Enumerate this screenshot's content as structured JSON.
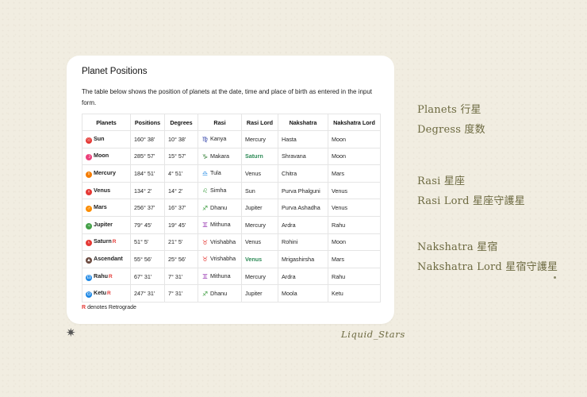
{
  "card": {
    "title": "Planet Positions",
    "description": "The table below shows the position of planets at the date, time and place of birth as entered in the input form.",
    "footnote_symbol": "R",
    "footnote_text": "denotes Retrograde"
  },
  "table": {
    "headers": [
      "Planets",
      "Positions",
      "Degrees",
      "Rasi",
      "Rasi Lord",
      "Nakshatra",
      "Nakshatra Lord"
    ],
    "rows": [
      {
        "planet": "Sun",
        "icon": "sun-icon",
        "icon_color": "#e53935",
        "retro": false,
        "position": "160° 38'",
        "degrees": "10° 38'",
        "rasi": "Kanya",
        "rasi_icon": "♍",
        "rasi_color": "#3949ab",
        "rasi_lord": "Mercury",
        "lord_bold": false,
        "nakshatra": "Hasta",
        "nakshatra_lord": "Moon"
      },
      {
        "planet": "Moon",
        "icon": "moon-icon",
        "icon_color": "#ec407a",
        "retro": false,
        "position": "285° 57'",
        "degrees": "15° 57'",
        "rasi": "Makara",
        "rasi_icon": "♑",
        "rasi_color": "#2e7d32",
        "rasi_lord": "Saturn",
        "lord_bold": true,
        "nakshatra": "Shravana",
        "nakshatra_lord": "Moon"
      },
      {
        "planet": "Mercury",
        "icon": "mercury-icon",
        "icon_color": "#f57c00",
        "retro": false,
        "position": "184° 51'",
        "degrees": "4° 51'",
        "rasi": "Tula",
        "rasi_icon": "♎",
        "rasi_color": "#1e88e5",
        "rasi_lord": "Venus",
        "lord_bold": false,
        "nakshatra": "Chitra",
        "nakshatra_lord": "Mars"
      },
      {
        "planet": "Venus",
        "icon": "venus-icon",
        "icon_color": "#e53935",
        "retro": false,
        "position": "134° 2'",
        "degrees": "14° 2'",
        "rasi": "Simha",
        "rasi_icon": "♌",
        "rasi_color": "#43a047",
        "rasi_lord": "Sun",
        "lord_bold": false,
        "nakshatra": "Purva Phalguni",
        "nakshatra_lord": "Venus"
      },
      {
        "planet": "Mars",
        "icon": "mars-icon",
        "icon_color": "#fb8c00",
        "retro": false,
        "position": "256° 37'",
        "degrees": "16° 37'",
        "rasi": "Dhanu",
        "rasi_icon": "♐",
        "rasi_color": "#43a047",
        "rasi_lord": "Jupiter",
        "lord_bold": false,
        "nakshatra": "Purva Ashadha",
        "nakshatra_lord": "Venus"
      },
      {
        "planet": "Jupiter",
        "icon": "jupiter-icon",
        "icon_color": "#43a047",
        "retro": false,
        "position": "79° 45'",
        "degrees": "19° 45'",
        "rasi": "Mithuna",
        "rasi_icon": "♊",
        "rasi_color": "#8e24aa",
        "rasi_lord": "Mercury",
        "lord_bold": false,
        "nakshatra": "Ardra",
        "nakshatra_lord": "Rahu"
      },
      {
        "planet": "Saturn",
        "icon": "saturn-icon",
        "icon_color": "#e53935",
        "retro": true,
        "position": "51° 5'",
        "degrees": "21° 5'",
        "rasi": "Vrishabha",
        "rasi_icon": "♉",
        "rasi_color": "#e53935",
        "rasi_lord": "Venus",
        "lord_bold": false,
        "nakshatra": "Rohini",
        "nakshatra_lord": "Moon"
      },
      {
        "planet": "Ascendant",
        "icon": "ascendant-icon",
        "icon_color": "#6d4c41",
        "retro": false,
        "position": "55° 56'",
        "degrees": "25° 56'",
        "rasi": "Vrishabha",
        "rasi_icon": "♉",
        "rasi_color": "#e53935",
        "rasi_lord": "Venus",
        "lord_bold": true,
        "nakshatra": "Mrigashirsha",
        "nakshatra_lord": "Mars"
      },
      {
        "planet": "Rahu",
        "icon": "rahu-icon",
        "icon_color": "#1e88e5",
        "retro": true,
        "position": "67° 31'",
        "degrees": "7° 31'",
        "rasi": "Mithuna",
        "rasi_icon": "♊",
        "rasi_color": "#8e24aa",
        "rasi_lord": "Mercury",
        "lord_bold": false,
        "nakshatra": "Ardra",
        "nakshatra_lord": "Rahu"
      },
      {
        "planet": "Ketu",
        "icon": "ketu-icon",
        "icon_color": "#1e88e5",
        "retro": true,
        "position": "247° 31'",
        "degrees": "7° 31'",
        "rasi": "Dhanu",
        "rasi_icon": "♐",
        "rasi_color": "#43a047",
        "rasi_lord": "Jupiter",
        "lord_bold": false,
        "nakshatra": "Moola",
        "nakshatra_lord": "Ketu"
      }
    ]
  },
  "legend": {
    "group1": [
      "Planets 行星",
      "Degress 度数"
    ],
    "group2": [
      "Rasi 星座",
      "Rasi Lord 星座守護星"
    ],
    "group3": [
      "Nakshatra 星宿",
      "Nakshatra Lord 星宿守護星"
    ]
  },
  "signature": "Liquid_Stars",
  "colors": {
    "accent_green": "#2e8b57",
    "retro_red": "#e53935",
    "legend_olive": "#6d6a41"
  }
}
